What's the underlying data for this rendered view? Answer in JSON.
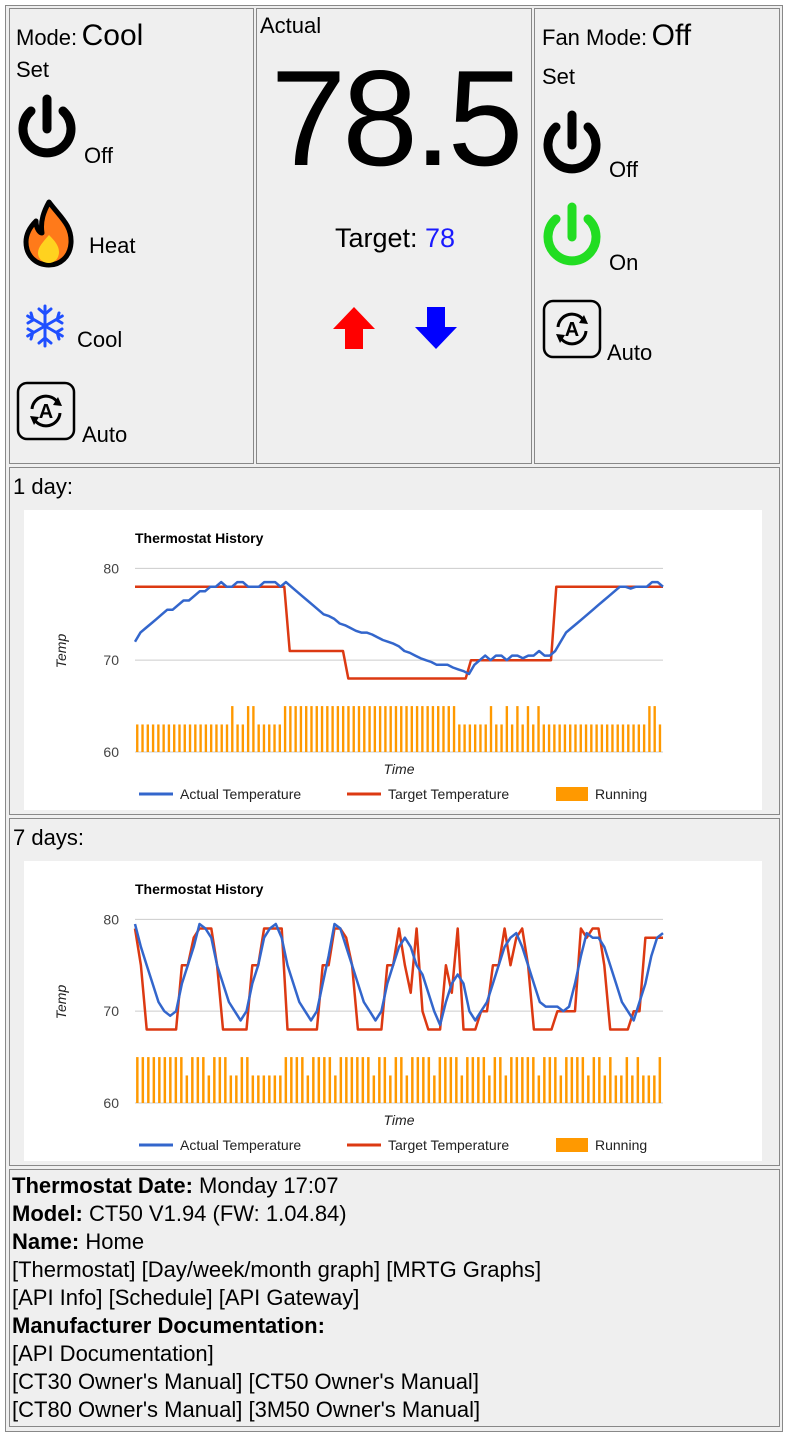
{
  "mode_panel": {
    "mode_label": "Mode:",
    "mode_value": "Cool",
    "set_label": "Set",
    "options": [
      {
        "label": "Off",
        "icon": "power-icon"
      },
      {
        "label": "Heat",
        "icon": "flame-icon"
      },
      {
        "label": "Cool",
        "icon": "snowflake-icon"
      },
      {
        "label": "Auto",
        "icon": "auto-icon"
      }
    ]
  },
  "actual_panel": {
    "actual_label": "Actual",
    "temperature": "78.5",
    "target_label": "Target:",
    "target_value": "78",
    "target_color": "#1a1aff",
    "up_color": "#ff0000",
    "down_color": "#0000ff"
  },
  "fan_panel": {
    "fan_label": "Fan Mode:",
    "fan_value": "Off",
    "set_label": "Set",
    "options": [
      {
        "label": "Off",
        "icon": "power-icon",
        "color": "#000000"
      },
      {
        "label": "On",
        "icon": "power-icon",
        "color": "#22dd22"
      },
      {
        "label": "Auto",
        "icon": "auto-icon",
        "color": "#000000"
      }
    ]
  },
  "charts_section": {
    "day_label": "1 day:",
    "week_label": "7 days:"
  },
  "chart_data": [
    {
      "type": "line",
      "title": "Thermostat History",
      "xlabel": "Time",
      "ylabel": "Temp",
      "ylim": [
        60,
        82
      ],
      "yticks": [
        60,
        70,
        80
      ],
      "grid": true,
      "legend_placement": "bottom",
      "series": [
        {
          "name": "Actual Temperature",
          "color": "#3366cc",
          "values": [
            72,
            73,
            73.5,
            74,
            74.5,
            75,
            75.5,
            75.5,
            76,
            76.5,
            76.5,
            77,
            77.5,
            77.5,
            78,
            78,
            78.5,
            78,
            78,
            78.5,
            78.5,
            78,
            78,
            78,
            78.5,
            78.5,
            78.5,
            78,
            78.5,
            78,
            77.5,
            77,
            76.5,
            76,
            75.5,
            75,
            74.8,
            74.5,
            74,
            73.8,
            73.5,
            73.2,
            73,
            73,
            72.8,
            72.5,
            72.2,
            72,
            71.8,
            71.5,
            71,
            70.8,
            70.5,
            70.2,
            70,
            69.8,
            69.5,
            69.5,
            69.5,
            69.2,
            69,
            68.8,
            68.5,
            69.5,
            70,
            70.5,
            70,
            70.5,
            70.5,
            70,
            70.5,
            70.5,
            70.2,
            70.5,
            70.5,
            71,
            70.5,
            70.5,
            71,
            72,
            73,
            73.5,
            74,
            74.5,
            75,
            75.5,
            76,
            76.5,
            77,
            77.5,
            78,
            78,
            77.8,
            78,
            78,
            78,
            78.5,
            78.5,
            78
          ]
        },
        {
          "name": "Target Temperature",
          "color": "#dc3912",
          "values": [
            78,
            78,
            78,
            78,
            78,
            78,
            78,
            78,
            78,
            78,
            78,
            78,
            78,
            78,
            78,
            78,
            78,
            78,
            78,
            78,
            78,
            78,
            78,
            78,
            78,
            78,
            78,
            78,
            78,
            71,
            71,
            71,
            71,
            71,
            71,
            71,
            71,
            71,
            71,
            71,
            68,
            68,
            68,
            68,
            68,
            68,
            68,
            68,
            68,
            68,
            68,
            68,
            68,
            68,
            68,
            68,
            68,
            68,
            68,
            68,
            68,
            68,
            68,
            70,
            70,
            70,
            70,
            70,
            70,
            70,
            70,
            70,
            70,
            70,
            70,
            70,
            70,
            70,
            70,
            78,
            78,
            78,
            78,
            78,
            78,
            78,
            78,
            78,
            78,
            78,
            78,
            78,
            78,
            78,
            78,
            78,
            78,
            78,
            78,
            78
          ]
        },
        {
          "name": "Running",
          "color": "#ff9900",
          "values": [
            63,
            63,
            63,
            63,
            63,
            63,
            63,
            63,
            63,
            63,
            63,
            63,
            63,
            63,
            63,
            63,
            63,
            63,
            65,
            63,
            63,
            65,
            65,
            63,
            63,
            63,
            63,
            63,
            65,
            65,
            65,
            65,
            65,
            65,
            65,
            65,
            65,
            65,
            65,
            65,
            65,
            65,
            65,
            65,
            65,
            65,
            65,
            65,
            65,
            65,
            65,
            65,
            65,
            65,
            65,
            65,
            65,
            65,
            65,
            65,
            65,
            63,
            63,
            63,
            63,
            63,
            63,
            65,
            63,
            63,
            65,
            63,
            65,
            63,
            65,
            63,
            65,
            63,
            63,
            63,
            63,
            63,
            63,
            63,
            63,
            63,
            63,
            63,
            63,
            63,
            63,
            63,
            63,
            63,
            63,
            63,
            63,
            65,
            65,
            63
          ]
        }
      ]
    },
    {
      "type": "line",
      "title": "Thermostat History",
      "xlabel": "Time",
      "ylabel": "Temp",
      "ylim": [
        60,
        82
      ],
      "yticks": [
        60,
        70,
        80
      ],
      "grid": true,
      "legend_placement": "bottom",
      "series": [
        {
          "name": "Actual Temperature",
          "color": "#3366cc",
          "values": [
            79.5,
            77,
            75,
            73,
            71,
            70,
            69.5,
            70,
            73,
            75,
            77,
            79.5,
            79,
            78,
            75,
            73,
            71,
            70,
            69,
            70,
            73,
            75,
            78,
            79,
            79.5,
            78,
            75,
            73,
            71,
            70,
            69,
            70,
            73,
            76,
            79.5,
            79,
            77,
            75,
            73,
            71,
            70,
            69,
            70,
            73,
            75,
            77,
            78,
            77,
            75,
            74,
            72,
            70,
            68.5,
            71,
            73,
            74,
            73,
            70,
            69,
            70,
            71,
            73,
            75,
            77,
            78,
            78.5,
            77,
            75,
            73,
            71,
            70.5,
            70.5,
            70.5,
            70,
            70.5,
            73,
            76,
            78.5,
            78,
            78,
            77,
            75,
            73,
            71,
            70,
            69,
            71,
            73,
            76,
            78,
            78.5
          ]
        },
        {
          "name": "Target Temperature",
          "color": "#dc3912",
          "values": [
            79,
            75,
            68,
            68,
            68,
            68,
            68,
            68,
            75,
            75,
            78,
            79,
            79,
            79,
            75,
            68,
            68,
            68,
            68,
            68,
            75,
            75,
            79,
            79,
            79,
            79,
            68,
            68,
            68,
            68,
            68,
            68,
            75,
            75,
            79,
            79,
            78,
            75,
            68,
            68,
            68,
            68,
            68,
            75,
            75,
            79,
            75,
            72,
            79,
            70,
            68,
            68,
            68,
            75,
            72,
            79,
            68,
            68,
            68,
            70,
            70,
            75,
            75,
            79,
            75,
            78,
            79,
            75,
            68,
            68,
            68,
            68,
            70,
            70,
            70,
            70,
            79,
            78,
            79,
            79,
            75,
            68,
            68,
            68,
            68,
            70,
            70,
            78,
            78,
            78,
            78
          ]
        },
        {
          "name": "Running",
          "color": "#ff9900",
          "values": [
            65,
            65,
            65,
            65,
            65,
            65,
            65,
            65,
            65,
            63,
            65,
            65,
            65,
            63,
            65,
            65,
            65,
            63,
            63,
            65,
            65,
            63,
            63,
            63,
            63,
            63,
            63,
            65,
            65,
            65,
            65,
            63,
            65,
            65,
            65,
            65,
            63,
            65,
            65,
            65,
            65,
            65,
            65,
            63,
            65,
            65,
            63,
            65,
            65,
            63,
            65,
            65,
            65,
            65,
            63,
            65,
            65,
            65,
            65,
            63,
            65,
            65,
            65,
            65,
            63,
            65,
            65,
            63,
            65,
            65,
            65,
            65,
            65,
            63,
            65,
            65,
            65,
            63,
            65,
            65,
            65,
            65,
            63,
            65,
            65,
            63,
            65,
            63,
            63,
            65,
            63,
            65,
            63,
            63,
            63,
            65
          ]
        }
      ]
    }
  ],
  "info": {
    "date_label": "Thermostat Date:",
    "date_value": "Monday 17:07",
    "model_label": "Model:",
    "model_value": "CT50 V1.94 (FW: 1.04.84)",
    "name_label": "Name:",
    "name_value": "Home",
    "links_row1": [
      "[Thermostat]",
      "[Day/week/month graph]",
      "[MRTG Graphs]"
    ],
    "links_row2": [
      "[API Info]",
      "[Schedule]",
      "[API Gateway]"
    ],
    "docs_label": "Manufacturer Documentation:",
    "links_row3": [
      "[API Documentation]"
    ],
    "links_row4": [
      "[CT30 Owner's Manual]",
      "[CT50 Owner's Manual]"
    ],
    "links_row5": [
      "[CT80 Owner's Manual]",
      "[3M50 Owner's Manual]"
    ]
  }
}
